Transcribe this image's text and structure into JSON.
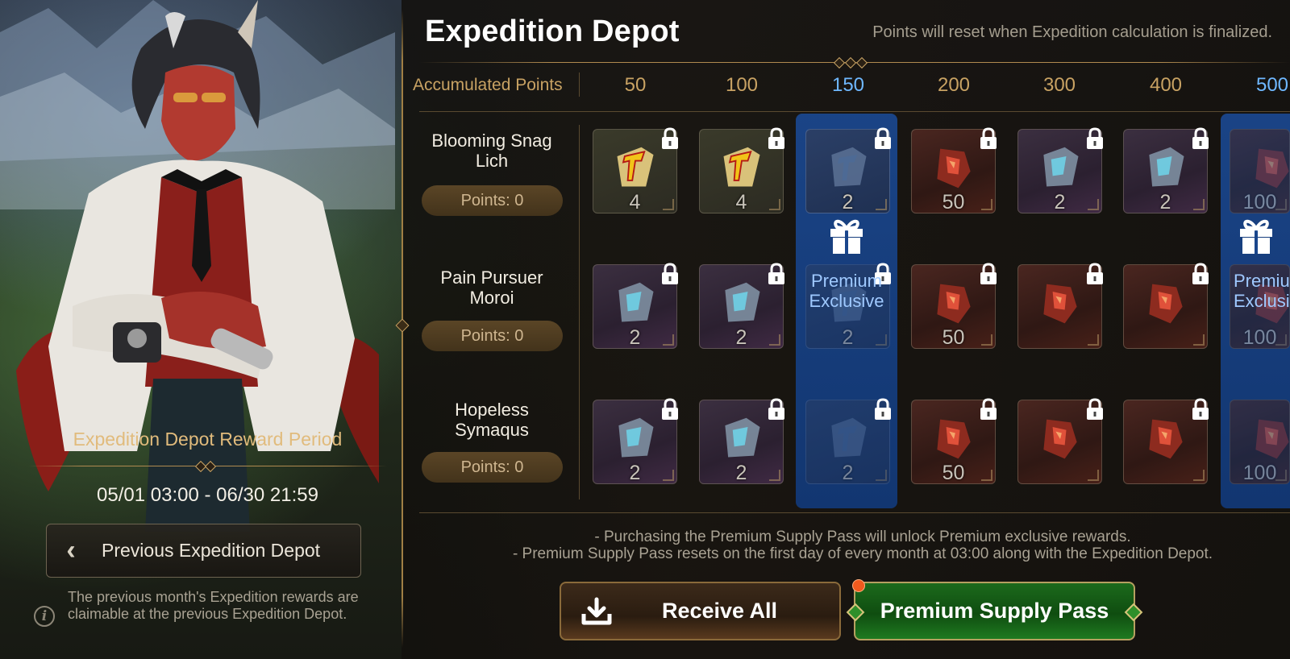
{
  "header": {
    "title": "Expedition Depot",
    "reset_note": "Points will reset when Expedition calculation is finalized."
  },
  "grid": {
    "accumulated_label": "Accumulated Points",
    "tiers": [
      "50",
      "100",
      "150",
      "200",
      "300",
      "400",
      "500"
    ],
    "highlighted_tiers": [
      "150",
      "500"
    ],
    "premium_label_line1": "Premium",
    "premium_label_line2": "Exclusive",
    "premium_partial_line1": "Premiu",
    "premium_partial_line2": "Exclusi",
    "rows": [
      {
        "name_line1": "Blooming Snag",
        "name_line2": "Lich",
        "points": "Points: 0",
        "rewards": [
          "4",
          "4",
          "2",
          "50",
          "2",
          "2",
          "100"
        ]
      },
      {
        "name_line1": "Pain Pursuer",
        "name_line2": "Moroi",
        "points": "Points: 0",
        "rewards": [
          "2",
          "2",
          "2",
          "50",
          "",
          "",
          "100"
        ]
      },
      {
        "name_line1": "Hopeless",
        "name_line2": "Symaqus",
        "points": "Points: 0",
        "rewards": [
          "2",
          "2",
          "2",
          "50",
          "",
          "",
          "100"
        ]
      }
    ]
  },
  "left_panel": {
    "reward_period_title": "Expedition Depot Reward Period",
    "period_dates": "05/01 03:00 - 06/30 21:59",
    "previous_button": "Previous Expedition Depot",
    "info_text": "The previous month's Expedition rewards are claimable at the previous Expedition Depot."
  },
  "notes": {
    "line1": "- Purchasing the Premium Supply Pass will unlock Premium exclusive rewards.",
    "line2": "- Premium Supply Pass resets on the first day of every month at 03:00 along with the Expedition Depot."
  },
  "buttons": {
    "receive_all": "Receive All",
    "premium_pass": "Premium Supply Pass"
  },
  "icons": {
    "locked": "lock-icon",
    "gift": "gift-icon",
    "download": "download-icon",
    "info": "info-icon",
    "back": "chevron-left-icon"
  },
  "colors": {
    "gold_text": "#c8a263",
    "highlight_blue": "#6fb8ff",
    "premium_column": "#1a468c",
    "pass_green": "#1c6a1c",
    "notification": "#f05a1e"
  }
}
